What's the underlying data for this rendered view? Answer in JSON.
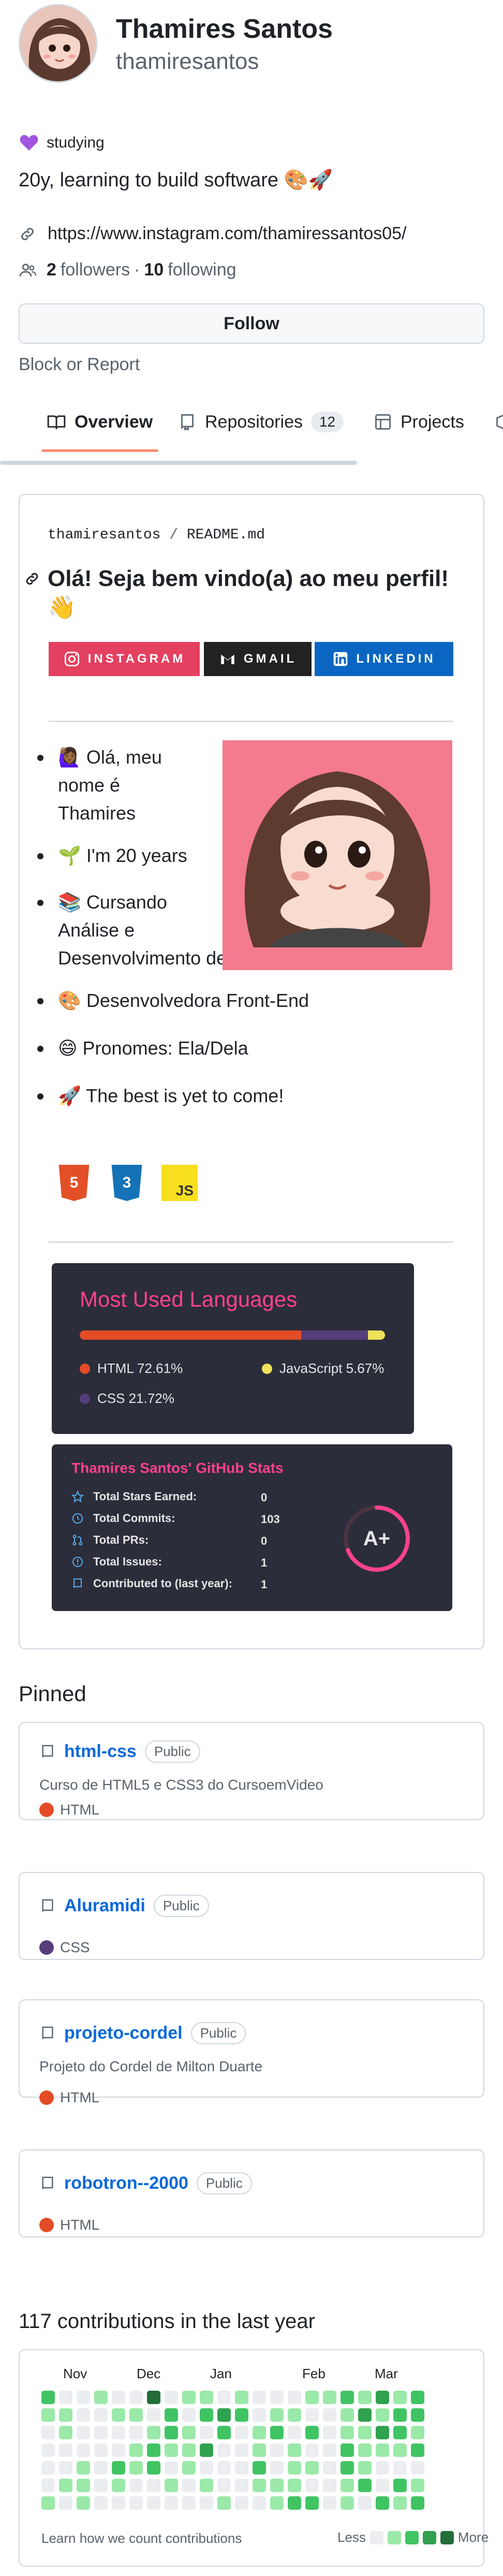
{
  "profile": {
    "full_name": "Thamires Santos",
    "username": "thamiresantos",
    "status": "studying",
    "bio": "20y, learning to build software 🎨🚀",
    "website": "https://www.instagram.com/thamiressantos05/",
    "followers_count": "2",
    "followers_label": "followers",
    "separator": "·",
    "following_count": "10",
    "following_label": "following",
    "follow_label": "Follow",
    "block_label": "Block or Report"
  },
  "tabs": [
    {
      "label": "Overview"
    },
    {
      "label": "Repositories",
      "count": "12"
    },
    {
      "label": "Projects"
    }
  ],
  "readme": {
    "path_user": "thamiresantos",
    "path_sep": "/",
    "path_file": "README",
    "path_ext": ".md",
    "title": "Olá! Seja bem vindo(a) ao meu perfil! 👋",
    "badges": [
      {
        "label": "INSTAGRAM",
        "color": "#e4405f"
      },
      {
        "label": "GMAIL",
        "color": "#222222"
      },
      {
        "label": "LINKEDIN",
        "color": "#0a66c2"
      }
    ],
    "bullets": [
      {
        "line1": "🙋🏾‍♀️ Olá, meu",
        "line2": "nome é",
        "line3": "Thamires"
      },
      {
        "line1": "🌱 I'm 20 years"
      },
      {
        "line1": "📚 Cursando",
        "line2": "Análise e",
        "line3": "Desenvolvimento de Sistemas - UNIFSA"
      },
      {
        "line1": "🎨 Desenvolvedora Front-End"
      },
      {
        "line1": "😄 Pronomes: Ela/Dela"
      },
      {
        "line1": "🚀 The best is yet to come!"
      }
    ],
    "tech_icons": [
      {
        "label": "5",
        "color": "#e34f26"
      },
      {
        "label": "3",
        "color": "#1572b6"
      },
      {
        "label": "JS",
        "color": "#f7df1e"
      }
    ]
  },
  "languages_card": {
    "title": "Most Used Languages",
    "items": [
      {
        "name": "HTML",
        "percent": 72.61,
        "label": "HTML 72.61%",
        "color": "#e34c26"
      },
      {
        "name": "CSS",
        "percent": 21.72,
        "label": "CSS 21.72%",
        "color": "#563d7c"
      },
      {
        "name": "JavaScript",
        "percent": 5.67,
        "label": "JavaScript 5.67%",
        "color": "#f1e05a"
      }
    ]
  },
  "stats_card": {
    "title": "Thamires Santos' GitHub Stats",
    "rows": [
      {
        "label": "Total Stars Earned:",
        "value": "0",
        "icon": "star-icon"
      },
      {
        "label": "Total Commits:",
        "value": "103",
        "icon": "clock-icon"
      },
      {
        "label": "Total PRs:",
        "value": "0",
        "icon": "pull-request-icon"
      },
      {
        "label": "Total Issues:",
        "value": "1",
        "icon": "issue-icon"
      },
      {
        "label": "Contributed to (last year):",
        "value": "1",
        "icon": "repo-icon"
      }
    ],
    "grade": "A+",
    "accent": "#fe428e"
  },
  "pinned": {
    "title": "Pinned",
    "repos": [
      {
        "name": "html-css",
        "visibility": "Public",
        "description": "Curso de HTML5 e CSS3 do CursoemVideo",
        "language": "HTML",
        "lang_color": "#e34c26"
      },
      {
        "name": "Aluramidi",
        "visibility": "Public",
        "description": "",
        "language": "CSS",
        "lang_color": "#563d7c"
      },
      {
        "name": "projeto-cordel",
        "visibility": "Public",
        "description": "Projeto do Cordel de Milton Duarte",
        "language": "HTML",
        "lang_color": "#e34c26"
      },
      {
        "name": "robotron--2000",
        "visibility": "Public",
        "description": "",
        "language": "HTML",
        "lang_color": "#e34c26"
      }
    ]
  },
  "contributions": {
    "title": "117 contributions in the last year",
    "months": [
      "Nov",
      "Dec",
      "Jan",
      "Feb",
      "Mar"
    ],
    "footer": "Learn how we count contributions",
    "less": "Less",
    "more": "More",
    "colors": [
      "#ebedf0",
      "#9be9a8",
      "#40c463",
      "#30a14e",
      "#216e39"
    ]
  }
}
